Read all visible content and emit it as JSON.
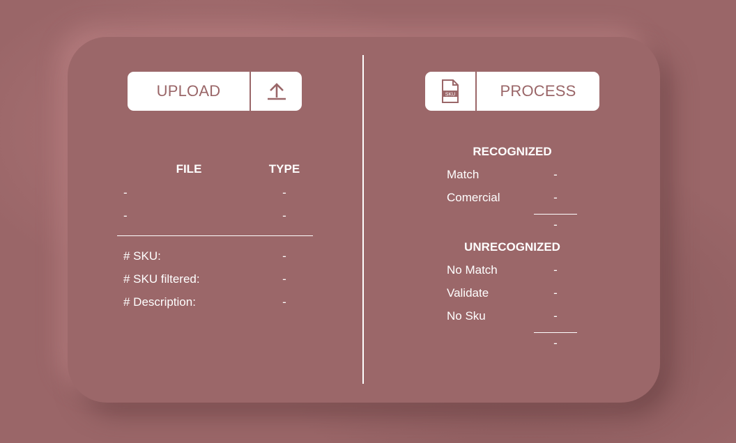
{
  "upload": {
    "label": "UPLOAD",
    "icon": "upload-icon"
  },
  "process": {
    "label": "PROCESS",
    "icon": "sku-file-icon",
    "icon_text": "SKU"
  },
  "file_table": {
    "headers": {
      "file": "FILE",
      "type": "TYPE"
    },
    "rows": [
      {
        "file": "-",
        "type": "-"
      },
      {
        "file": "-",
        "type": "-"
      }
    ]
  },
  "stats": [
    {
      "label": "# SKU:",
      "value": "-"
    },
    {
      "label": "# SKU filtered:",
      "value": "-"
    },
    {
      "label": "# Description:",
      "value": "-"
    }
  ],
  "recognized": {
    "title": "RECOGNIZED",
    "rows": [
      {
        "label": "Match",
        "value": "-"
      },
      {
        "label": "Comercial",
        "value": "-"
      }
    ],
    "total": "-"
  },
  "unrecognized": {
    "title": "UNRECOGNIZED",
    "rows": [
      {
        "label": "No Match",
        "value": "-"
      },
      {
        "label": "Validate",
        "value": "-"
      },
      {
        "label": "No Sku",
        "value": "-"
      }
    ],
    "total": "-"
  },
  "colors": {
    "background": "#9a6668",
    "panel": "#9b6769",
    "button_bg": "#ffffff",
    "accent": "#9a6668",
    "text": "#ffffff"
  }
}
